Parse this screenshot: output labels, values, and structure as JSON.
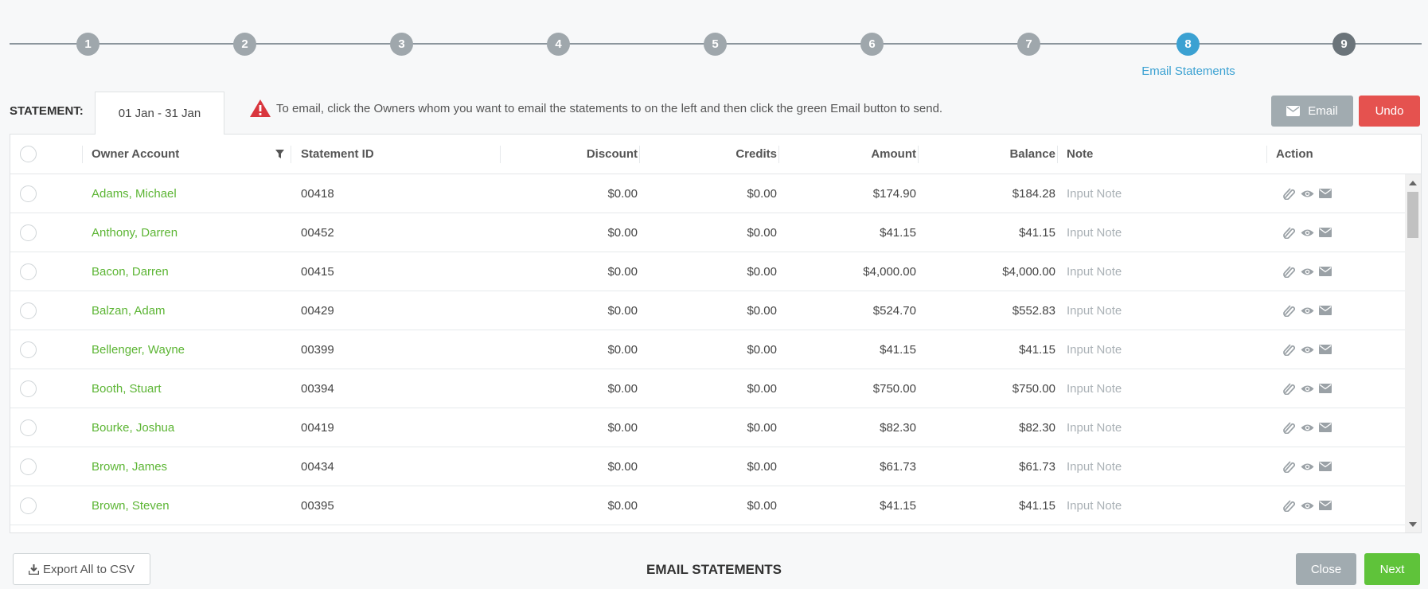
{
  "stepper": {
    "steps": [
      "1",
      "2",
      "3",
      "4",
      "5",
      "6",
      "7",
      "8",
      "9"
    ],
    "active_label": "Email Statements"
  },
  "statement": {
    "label": "STATEMENT:",
    "period": "01 Jan - 31 Jan"
  },
  "notice": "To email, click the Owners whom you want to email the statements to on the left and then click the green Email button to send.",
  "toolbar": {
    "email_label": "Email",
    "undo_label": "Undo"
  },
  "table": {
    "headers": {
      "owner": "Owner Account",
      "statement_id": "Statement ID",
      "discount": "Discount",
      "credits": "Credits",
      "amount": "Amount",
      "balance": "Balance",
      "note": "Note",
      "action": "Action"
    },
    "note_placeholder": "Input Note",
    "rows": [
      {
        "owner": "Adams, Michael",
        "id": "00418",
        "discount": "$0.00",
        "credits": "$0.00",
        "amount": "$174.90",
        "balance": "$184.28"
      },
      {
        "owner": "Anthony, Darren",
        "id": "00452",
        "discount": "$0.00",
        "credits": "$0.00",
        "amount": "$41.15",
        "balance": "$41.15"
      },
      {
        "owner": "Bacon, Darren",
        "id": "00415",
        "discount": "$0.00",
        "credits": "$0.00",
        "amount": "$4,000.00",
        "balance": "$4,000.00"
      },
      {
        "owner": "Balzan, Adam",
        "id": "00429",
        "discount": "$0.00",
        "credits": "$0.00",
        "amount": "$524.70",
        "balance": "$552.83"
      },
      {
        "owner": "Bellenger, Wayne",
        "id": "00399",
        "discount": "$0.00",
        "credits": "$0.00",
        "amount": "$41.15",
        "balance": "$41.15"
      },
      {
        "owner": "Booth, Stuart",
        "id": "00394",
        "discount": "$0.00",
        "credits": "$0.00",
        "amount": "$750.00",
        "balance": "$750.00"
      },
      {
        "owner": "Bourke, Joshua",
        "id": "00419",
        "discount": "$0.00",
        "credits": "$0.00",
        "amount": "$82.30",
        "balance": "$82.30"
      },
      {
        "owner": "Brown, James",
        "id": "00434",
        "discount": "$0.00",
        "credits": "$0.00",
        "amount": "$61.73",
        "balance": "$61.73"
      },
      {
        "owner": "Brown, Steven",
        "id": "00395",
        "discount": "$0.00",
        "credits": "$0.00",
        "amount": "$41.15",
        "balance": "$41.15"
      }
    ]
  },
  "footer": {
    "export_label": "Export All to CSV",
    "title": "EMAIL STATEMENTS",
    "close_label": "Close",
    "next_label": "Next"
  },
  "colors": {
    "accent": "#3ba1d2",
    "owner_link": "#5cb534",
    "undo": "#e5524f",
    "next": "#5fc33a",
    "warning": "#d9363e"
  },
  "icons": {
    "warning": "warning-triangle-icon",
    "email": "envelope-icon",
    "filter": "filter-icon",
    "attachment": "paperclip-icon",
    "view": "eye-icon",
    "download": "download-icon"
  }
}
